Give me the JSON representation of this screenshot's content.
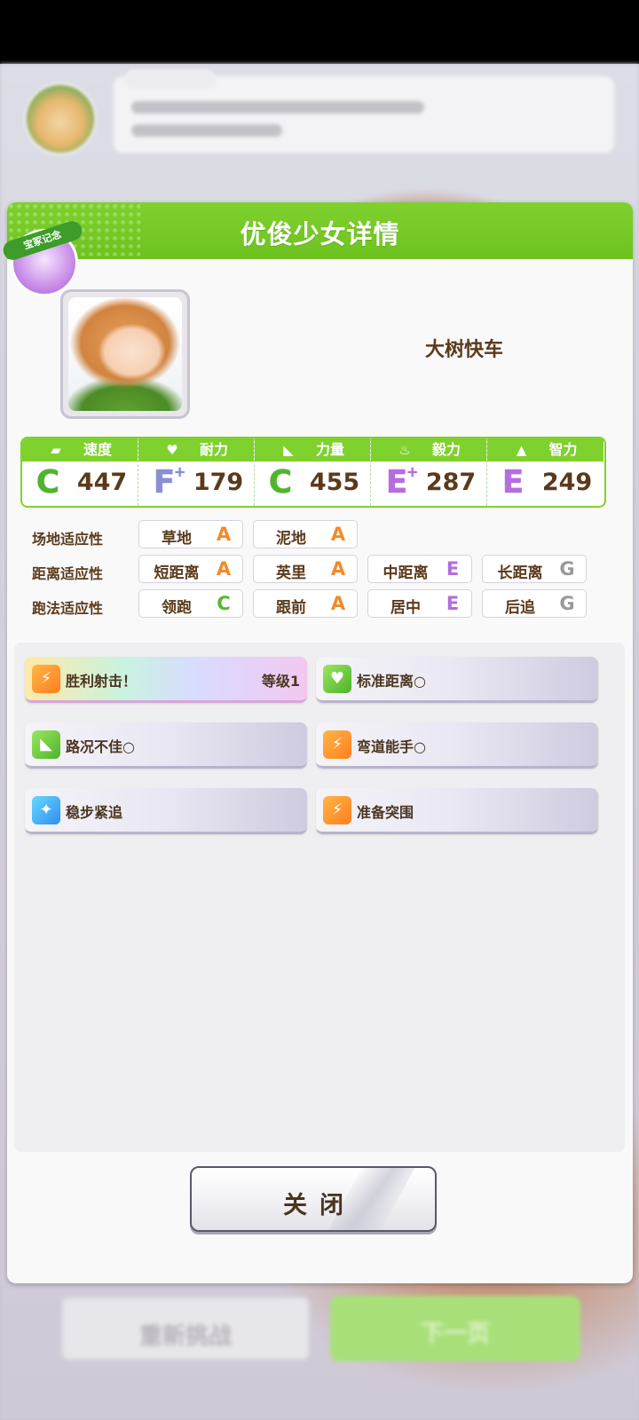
{
  "background": {
    "bubble_speaker_blur": "",
    "retry_button_label": "重新挑战",
    "next_button_label": "下一页"
  },
  "dialog": {
    "title": "优俊少女详情",
    "badge_label": "宝冢记念",
    "character_name": "大树快车",
    "stats": [
      {
        "label": "速度",
        "icon": "shoe-icon",
        "grade": "C",
        "plus": "",
        "value": "447"
      },
      {
        "label": "耐力",
        "icon": "heart-icon",
        "grade": "F",
        "plus": "+",
        "value": "179"
      },
      {
        "label": "力量",
        "icon": "muscle-icon",
        "grade": "C",
        "plus": "",
        "value": "455"
      },
      {
        "label": "毅力",
        "icon": "flame-icon",
        "grade": "E",
        "plus": "+",
        "value": "287"
      },
      {
        "label": "智力",
        "icon": "graduation-cap-icon",
        "grade": "E",
        "plus": "",
        "value": "249"
      }
    ],
    "aptitudes": {
      "track": {
        "label": "场地适应性",
        "items": [
          {
            "name": "草地",
            "grade": "A"
          },
          {
            "name": "泥地",
            "grade": "A"
          }
        ]
      },
      "distance": {
        "label": "距离适应性",
        "items": [
          {
            "name": "短距离",
            "grade": "A"
          },
          {
            "name": "英里",
            "grade": "A"
          },
          {
            "name": "中距离",
            "grade": "E"
          },
          {
            "name": "长距离",
            "grade": "G"
          }
        ]
      },
      "style": {
        "label": "跑法适应性",
        "items": [
          {
            "name": "领跑",
            "grade": "C"
          },
          {
            "name": "跟前",
            "grade": "A"
          },
          {
            "name": "居中",
            "grade": "E"
          },
          {
            "name": "后追",
            "grade": "G"
          }
        ]
      }
    },
    "skills": [
      {
        "name": "胜利射击！",
        "level": "等级1",
        "icon": "speed-runner-icon",
        "type": "gold"
      },
      {
        "name": "标准距离○",
        "level": "",
        "icon": "heart-icon",
        "type": "normal"
      },
      {
        "name": "路况不佳○",
        "level": "",
        "icon": "muscle-icon",
        "type": "normal"
      },
      {
        "name": "弯道能手○",
        "level": "",
        "icon": "speed-runner-icon",
        "type": "normal"
      },
      {
        "name": "稳步紧追",
        "level": "",
        "icon": "sparkle-icon",
        "type": "normal"
      },
      {
        "name": "准备突围",
        "level": "",
        "icon": "speed-runner-icon",
        "type": "normal"
      }
    ],
    "close_label": "关闭"
  }
}
